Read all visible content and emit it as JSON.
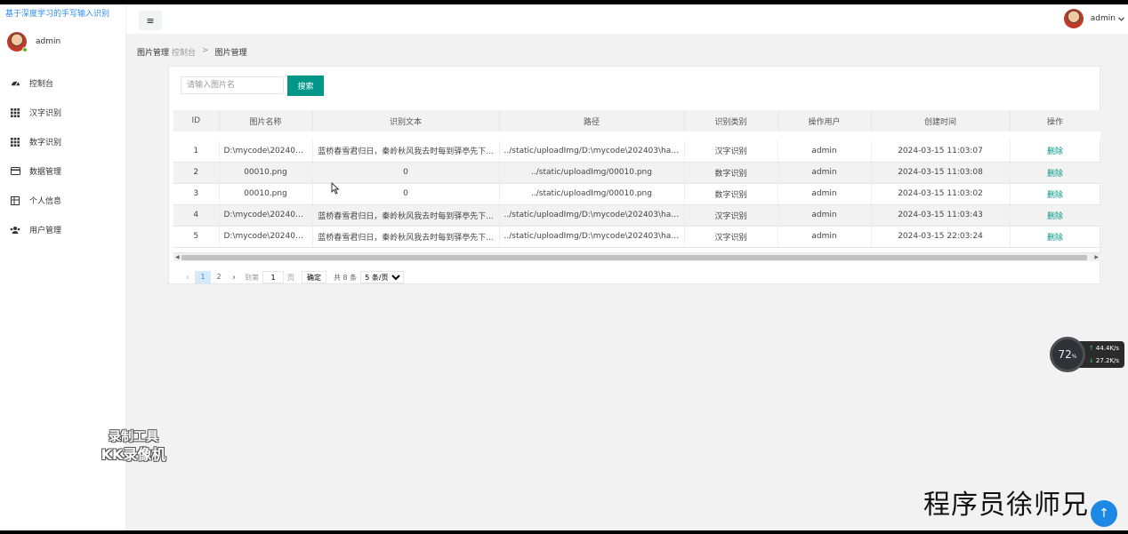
{
  "app": {
    "title": "基于深度学习的手写输入识别",
    "user": "admin"
  },
  "sidebar": {
    "items": [
      {
        "label": "控制台",
        "icon": "dashboard-icon"
      },
      {
        "label": "汉字识别",
        "icon": "grid-icon"
      },
      {
        "label": "数字识别",
        "icon": "grid-icon"
      },
      {
        "label": "数据管理",
        "icon": "card-icon"
      },
      {
        "label": "个人信息",
        "icon": "table-icon"
      },
      {
        "label": "用户管理",
        "icon": "users-icon"
      }
    ]
  },
  "header": {
    "menu_icon": "≡",
    "user": "admin"
  },
  "breadcrumb": {
    "root": "图片管理",
    "sub": "控制台",
    "sep": ">",
    "current": "图片管理"
  },
  "search": {
    "placeholder": "请输入图片名",
    "button": "搜索"
  },
  "table": {
    "columns": [
      "ID",
      "图片名称",
      "识别文本",
      "路径",
      "识别类别",
      "操作用户",
      "创建时间",
      "操作"
    ],
    "rows": [
      {
        "id": "1",
        "name": "D:\\mycode\\202403...",
        "text": "蓝桥春雪君归日，秦岭秋风我去时每到驿亭先下...",
        "path": "../static/uploadImg/D:\\mycode\\202403\\hand...",
        "category": "汉字识别",
        "user": "admin",
        "time": "2024-03-15 11:03:07",
        "action": "删除"
      },
      {
        "id": "2",
        "name": "00010.png",
        "text": "0",
        "path": "../static/uploadImg/00010.png",
        "category": "数字识别",
        "user": "admin",
        "time": "2024-03-15 11:03:08",
        "action": "删除"
      },
      {
        "id": "3",
        "name": "00010.png",
        "text": "0",
        "path": "../static/uploadImg/00010.png",
        "category": "数字识别",
        "user": "admin",
        "time": "2024-03-15 11:03:02",
        "action": "删除"
      },
      {
        "id": "4",
        "name": "D:\\mycode\\202403...",
        "text": "蓝桥春雪君归日，秦岭秋风我去时每到驿亭先下...",
        "path": "../static/uploadImg/D:\\mycode\\202403\\hand...",
        "category": "汉字识别",
        "user": "admin",
        "time": "2024-03-15 11:03:43",
        "action": "删除"
      },
      {
        "id": "5",
        "name": "D:\\mycode\\202403...",
        "text": "蓝桥春雪君归日，秦岭秋风我去时每到驿亭先下...",
        "path": "../static/uploadImg/D:\\mycode\\202403\\hand...",
        "category": "汉字识别",
        "user": "admin",
        "time": "2024-03-15 22:03:24",
        "action": "删除"
      }
    ]
  },
  "pagination": {
    "prev": "‹",
    "pages": [
      "1",
      "2"
    ],
    "active_page": "1",
    "next": "›",
    "goto_label": "到第",
    "goto_value": "1",
    "page_unit": "页",
    "confirm": "确定",
    "total": "共 8 条",
    "page_size": "5 条/页"
  },
  "overlay": {
    "percent": "72",
    "percent_unit": "%",
    "upload": "44.4",
    "upload_unit": "K/s",
    "download": "27.2",
    "download_unit": "K/s",
    "tool_line1": "录制工具",
    "tool_line2": "KK录像机",
    "author": "程序员徐师兄",
    "to_top": "↑"
  },
  "colors": {
    "accent": "#009688",
    "title_blue": "#2d8cf0",
    "sidebar_bg": "#ffffff",
    "main_bg": "#f2f2f2"
  }
}
